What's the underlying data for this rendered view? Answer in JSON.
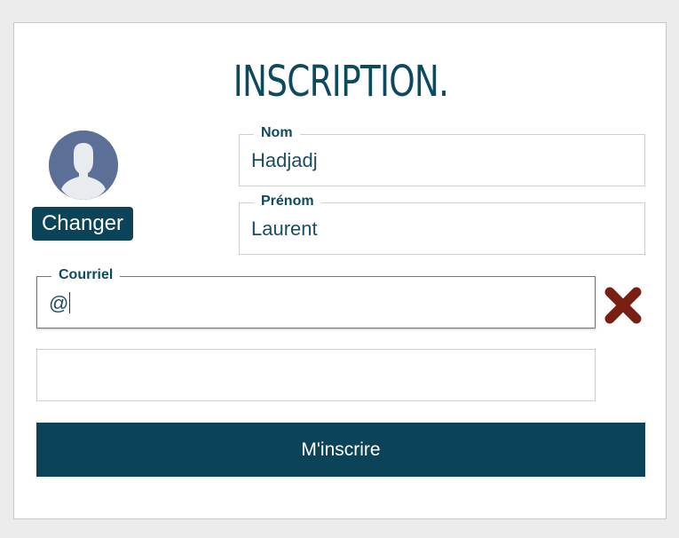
{
  "form": {
    "title": "INSCRIPTION.",
    "change_label": "Changer",
    "nom": {
      "label": "Nom",
      "value": "Hadjadj"
    },
    "prenom": {
      "label": "Prénom",
      "value": "Laurent"
    },
    "courriel": {
      "label": "Courriel",
      "value": "@"
    },
    "extra_field": {
      "value": ""
    },
    "submit_label": "M'inscrire"
  },
  "icons": {
    "avatar": "user-silhouette-icon",
    "clear": "close-x-icon"
  },
  "colors": {
    "primary": "#0b4459",
    "title": "#0e4a5e",
    "avatar_bg": "#5b6f97",
    "clear_icon": "#7a1f14",
    "page_bg": "#ececec"
  }
}
